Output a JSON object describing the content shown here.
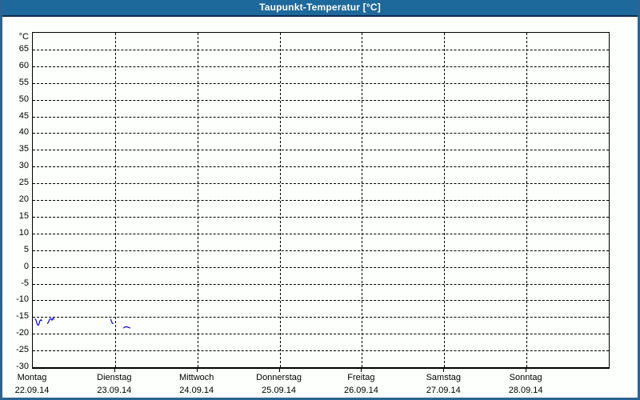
{
  "window": {
    "title": "Taupunkt-Temperatur [°C]"
  },
  "colors": {
    "titlebar_bg": "#1e699c",
    "titlebar_underline": "#0d2c50",
    "outer_border": "#2b6491",
    "background": "#fdfffc",
    "axis": "#000000",
    "grid": "#000000",
    "series_line": "#0000e0"
  },
  "chart_data": {
    "type": "line",
    "title": "Taupunkt-Temperatur [°C]",
    "ylabel": "°C",
    "xlabel": "",
    "ylim": [
      -30,
      70
    ],
    "ytick_step": 5,
    "ytick_values": [
      65,
      60,
      55,
      50,
      45,
      40,
      35,
      30,
      25,
      20,
      15,
      10,
      5,
      0,
      -5,
      -10,
      -15,
      -20,
      -25,
      -30
    ],
    "grid": "dashed",
    "legend": "none",
    "days": [
      {
        "label": "Montag",
        "date": "22.09.14"
      },
      {
        "label": "Dienstag",
        "date": "23.09.14"
      },
      {
        "label": "Mittwoch",
        "date": "24.09.14"
      },
      {
        "label": "Donnerstag",
        "date": "25.09.14"
      },
      {
        "label": "Freitag",
        "date": "26.09.14"
      },
      {
        "label": "Samstag",
        "date": "27.09.14"
      },
      {
        "label": "Sonntag",
        "date": "28.09.14"
      }
    ],
    "series": [
      {
        "name": "Taupunkt",
        "unit": "°C",
        "color": "#0000e0",
        "x_unit": "days_from_monday_start",
        "segments": [
          [
            [
              0.026,
              -15.5
            ],
            [
              0.039,
              -15.9
            ],
            [
              0.055,
              -17.3
            ],
            [
              0.071,
              -17.4
            ],
            [
              0.087,
              -16.1
            ],
            [
              0.1,
              -15.8
            ],
            [
              0.112,
              -16.2
            ]
          ],
          [
            [
              0.178,
              -17.0
            ],
            [
              0.194,
              -16.3
            ],
            [
              0.207,
              -15.6
            ],
            [
              0.221,
              -15.5
            ],
            [
              0.233,
              -15.9
            ],
            [
              0.246,
              -15.3
            ],
            [
              0.262,
              -15.7
            ]
          ],
          [
            [
              0.946,
              -15.6
            ],
            [
              0.955,
              -16.2
            ],
            [
              0.965,
              -16.8
            ],
            [
              0.979,
              -17.0
            ]
          ],
          [
            [
              1.101,
              -18.3
            ],
            [
              1.118,
              -18.0
            ],
            [
              1.14,
              -17.9
            ],
            [
              1.166,
              -18.1
            ],
            [
              1.183,
              -18.3
            ]
          ]
        ]
      }
    ]
  }
}
